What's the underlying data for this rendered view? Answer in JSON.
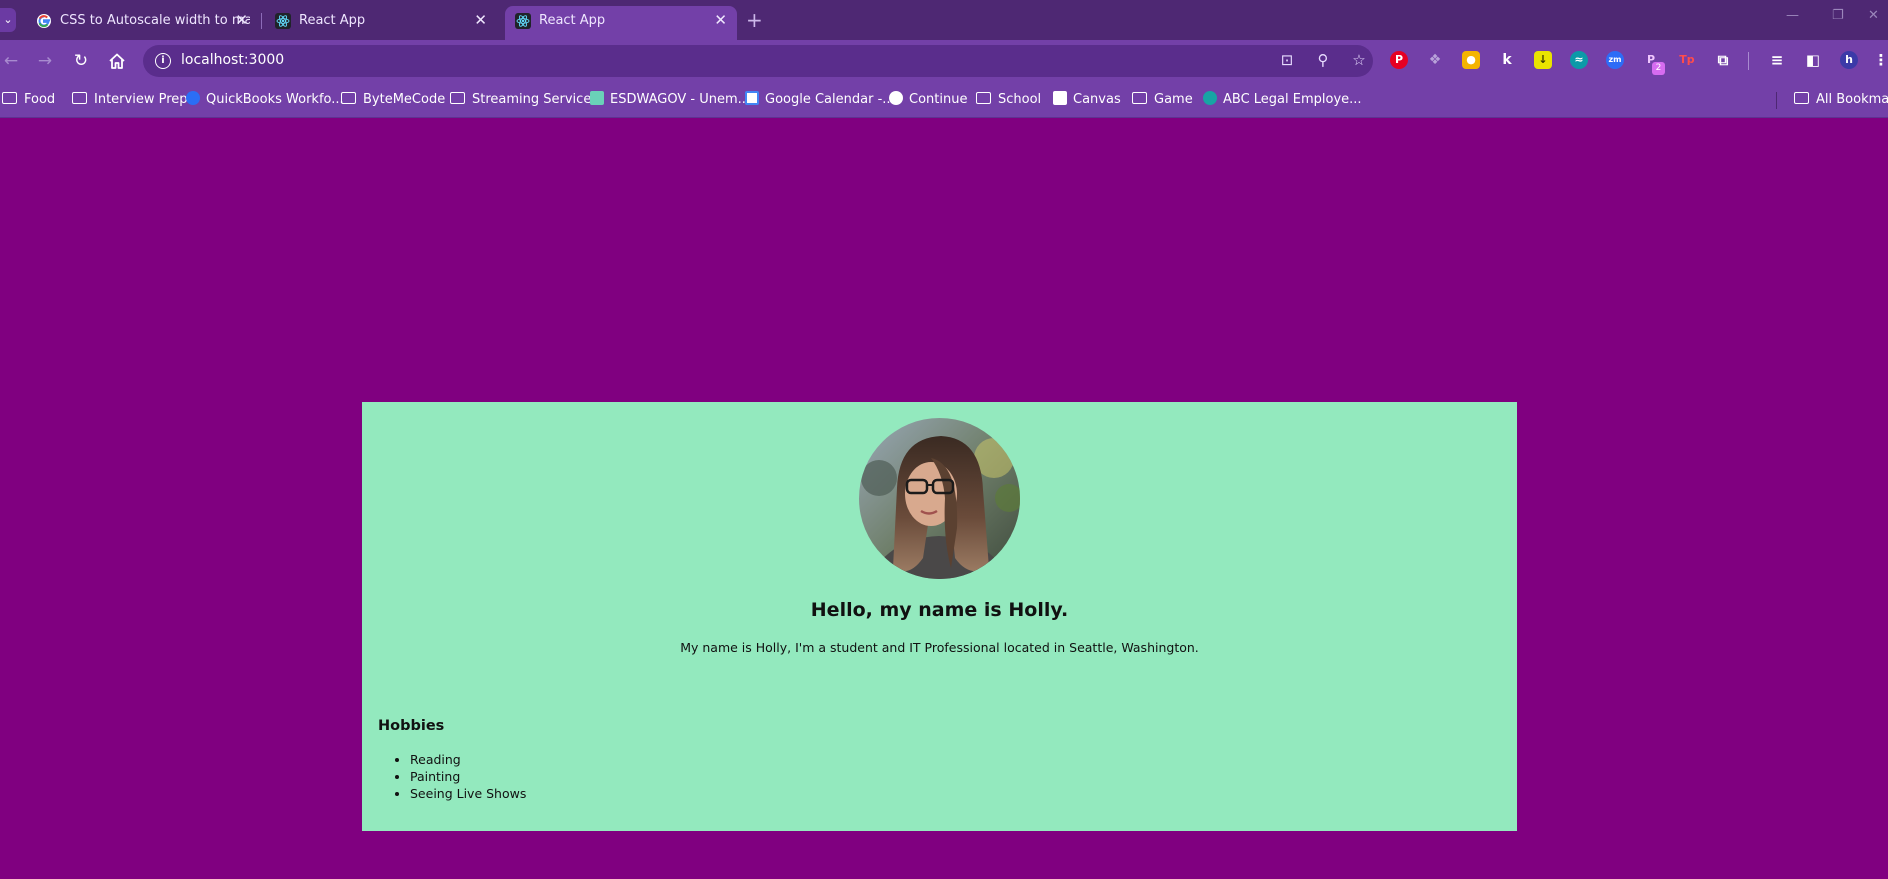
{
  "browser": {
    "tabs": [
      {
        "title": "CSS to Autoscale width to matc",
        "icon": "google-g-icon",
        "active": false
      },
      {
        "title": "React App",
        "icon": "react-icon",
        "active": false
      },
      {
        "title": "React App",
        "icon": "react-icon",
        "active": true
      }
    ],
    "new_tab_symbol": "+",
    "address": "localhost:3000",
    "bookmarks": [
      {
        "label": "Food",
        "icon": "folder-icon"
      },
      {
        "label": "Interview Prep",
        "icon": "folder-icon"
      },
      {
        "label": "QuickBooks Workfo...",
        "icon": "quickbooks-icon"
      },
      {
        "label": "ByteMeCode",
        "icon": "folder-icon"
      },
      {
        "label": "Streaming Services",
        "icon": "folder-icon"
      },
      {
        "label": "ESDWAGOV - Unem...",
        "icon": "esd-icon"
      },
      {
        "label": "Google Calendar -...",
        "icon": "calendar-icon"
      },
      {
        "label": "Continue",
        "icon": "globe-icon"
      },
      {
        "label": "School",
        "icon": "folder-icon"
      },
      {
        "label": "Canvas",
        "icon": "canvas-icon"
      },
      {
        "label": "Game",
        "icon": "folder-icon"
      },
      {
        "label": "ABC Legal Employe...",
        "icon": "abc-legal-icon"
      },
      {
        "label": "All Bookmark",
        "icon": "folder-icon"
      }
    ],
    "profile_initial": "h",
    "extension_badge": "2"
  },
  "page": {
    "headline": "Hello, my name is Holly.",
    "bio": "My name is Holly, I'm a student and IT Professional located in Seattle, Washington.",
    "hobbies_title": "Hobbies",
    "hobbies": [
      "Reading",
      "Painting",
      "Seeing Live Shows"
    ]
  },
  "colors": {
    "page_background": "#800080",
    "card_background": "#93e9be",
    "browser_frame": "#7340a8"
  }
}
